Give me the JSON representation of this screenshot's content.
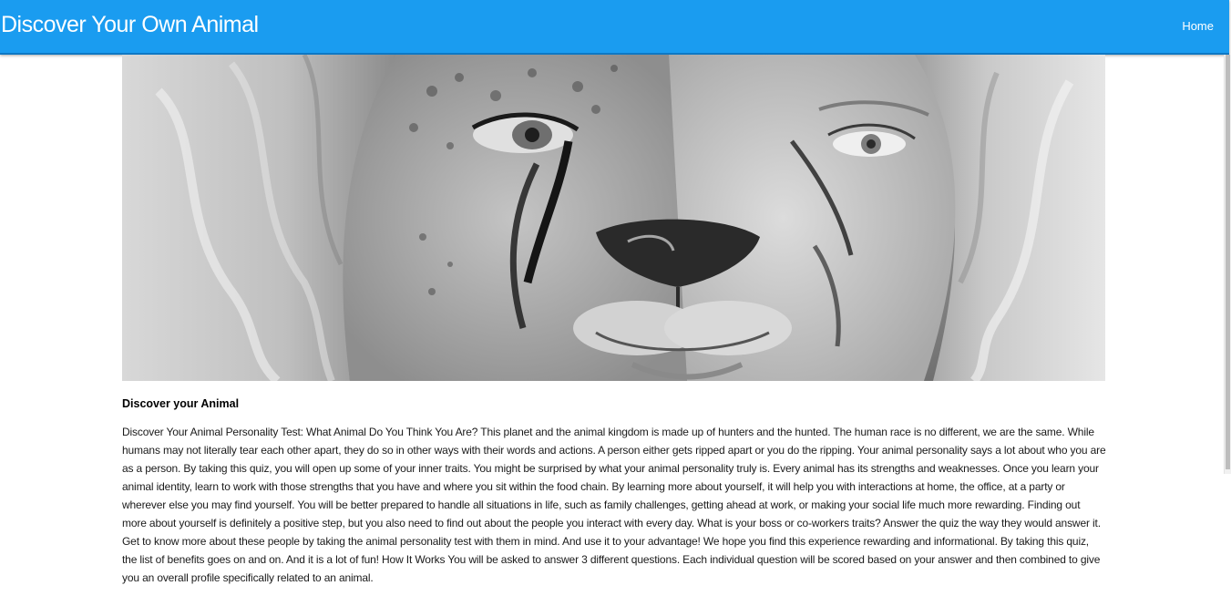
{
  "navbar": {
    "brand": "Discover Your Own Animal",
    "home_link": "Home",
    "background_color": "#1a9cf0"
  },
  "hero": {
    "icon": "cheetah-face-portrait-image"
  },
  "article": {
    "heading": "Discover your Animal",
    "body": "Discover Your Animal Personality Test: What Animal Do You Think You Are? This planet and the animal kingdom is made up of hunters and the hunted. The human race is no different, we are the same. While humans may not literally tear each other apart, they do so in other ways with their words and actions. A person either gets ripped apart or you do the ripping. Your animal personality says a lot about who you are as a person. By taking this quiz, you will open up some of your inner traits. You might be surprised by what your animal personality truly is. Every animal has its strengths and weaknesses. Once you learn your animal identity, learn to work with those strengths that you have and where you sit within the food chain. By learning more about yourself, it will help you with interactions at home, the office, at a party or wherever else you may find yourself. You will be better prepared to handle all situations in life, such as family challenges, getting ahead at work, or making your social life much more rewarding. Finding out more about yourself is definitely a positive step, but you also need to find out about the people you interact with every day. What is your boss or co-workers traits? Answer the quiz the way they would answer it. Get to know more about these people by taking the animal personality test with them in mind. And use it to your advantage! We hope you find this experience rewarding and informational. By taking this quiz, the list of benefits goes on and on. And it is a lot of fun! How It Works You will be asked to answer 3 different questions. Each individual question will be scored based on your answer and then combined to give you an overall profile specifically related to an animal."
  }
}
